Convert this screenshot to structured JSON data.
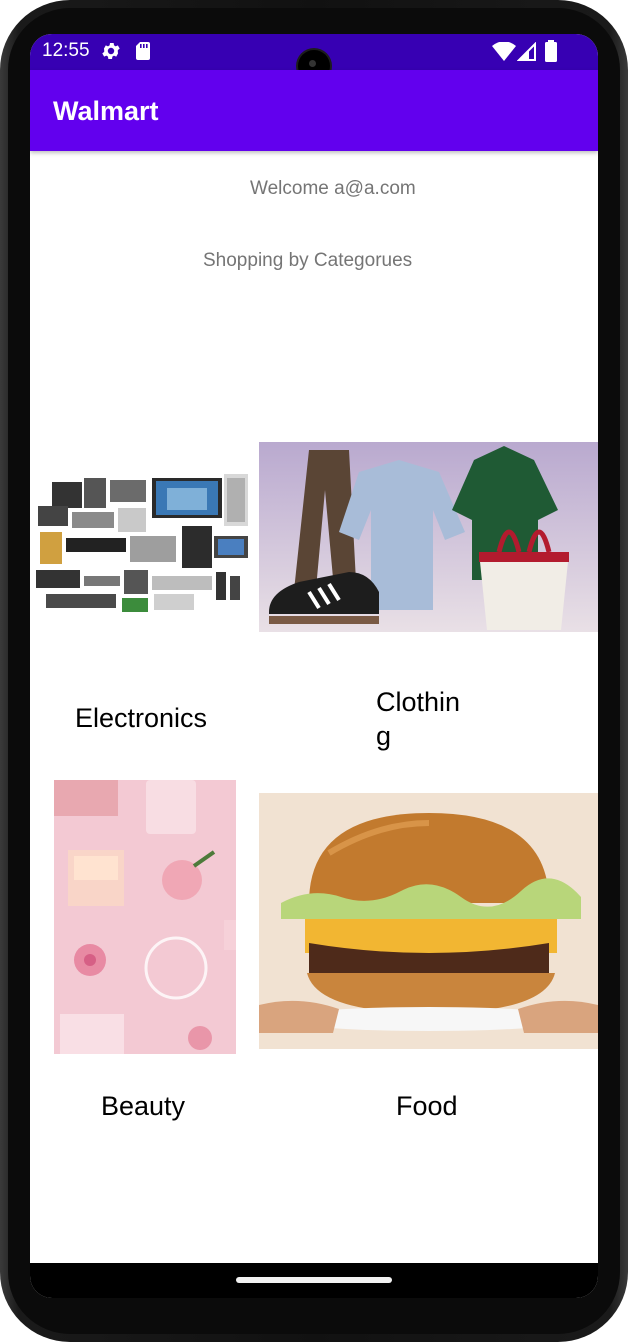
{
  "status_bar": {
    "time": "12:55",
    "icons": [
      "gear-icon",
      "sd-card-icon",
      "wifi-icon",
      "cell-signal-icon",
      "battery-icon"
    ],
    "background": "#3700b3"
  },
  "app_bar": {
    "title": "Walmart",
    "background": "#6200ee"
  },
  "main": {
    "welcome": "Welcome a@a.com",
    "subtitle": "Shopping by Categorues",
    "categories": [
      {
        "label": "Electronics",
        "image": "electronics-image"
      },
      {
        "label": "Clothin\ng",
        "image": "clothing-image"
      },
      {
        "label": "Beauty",
        "image": "beauty-image"
      },
      {
        "label": "Food",
        "image": "food-image"
      }
    ]
  }
}
